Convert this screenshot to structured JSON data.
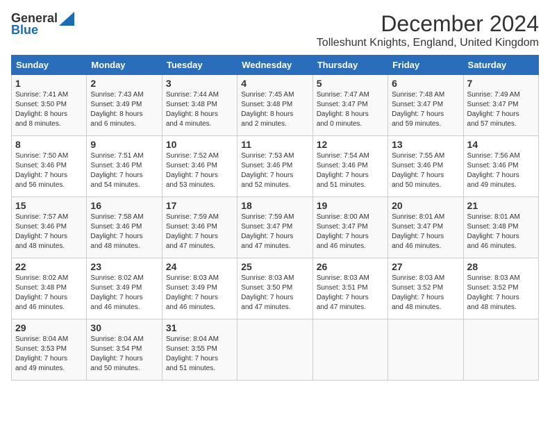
{
  "header": {
    "logo_general": "General",
    "logo_blue": "Blue",
    "month": "December 2024",
    "location": "Tolleshunt Knights, England, United Kingdom"
  },
  "days_of_week": [
    "Sunday",
    "Monday",
    "Tuesday",
    "Wednesday",
    "Thursday",
    "Friday",
    "Saturday"
  ],
  "weeks": [
    [
      {
        "day": 1,
        "info": "Sunrise: 7:41 AM\nSunset: 3:50 PM\nDaylight: 8 hours\nand 8 minutes."
      },
      {
        "day": 2,
        "info": "Sunrise: 7:43 AM\nSunset: 3:49 PM\nDaylight: 8 hours\nand 6 minutes."
      },
      {
        "day": 3,
        "info": "Sunrise: 7:44 AM\nSunset: 3:48 PM\nDaylight: 8 hours\nand 4 minutes."
      },
      {
        "day": 4,
        "info": "Sunrise: 7:45 AM\nSunset: 3:48 PM\nDaylight: 8 hours\nand 2 minutes."
      },
      {
        "day": 5,
        "info": "Sunrise: 7:47 AM\nSunset: 3:47 PM\nDaylight: 8 hours\nand 0 minutes."
      },
      {
        "day": 6,
        "info": "Sunrise: 7:48 AM\nSunset: 3:47 PM\nDaylight: 7 hours\nand 59 minutes."
      },
      {
        "day": 7,
        "info": "Sunrise: 7:49 AM\nSunset: 3:47 PM\nDaylight: 7 hours\nand 57 minutes."
      }
    ],
    [
      {
        "day": 8,
        "info": "Sunrise: 7:50 AM\nSunset: 3:46 PM\nDaylight: 7 hours\nand 56 minutes."
      },
      {
        "day": 9,
        "info": "Sunrise: 7:51 AM\nSunset: 3:46 PM\nDaylight: 7 hours\nand 54 minutes."
      },
      {
        "day": 10,
        "info": "Sunrise: 7:52 AM\nSunset: 3:46 PM\nDaylight: 7 hours\nand 53 minutes."
      },
      {
        "day": 11,
        "info": "Sunrise: 7:53 AM\nSunset: 3:46 PM\nDaylight: 7 hours\nand 52 minutes."
      },
      {
        "day": 12,
        "info": "Sunrise: 7:54 AM\nSunset: 3:46 PM\nDaylight: 7 hours\nand 51 minutes."
      },
      {
        "day": 13,
        "info": "Sunrise: 7:55 AM\nSunset: 3:46 PM\nDaylight: 7 hours\nand 50 minutes."
      },
      {
        "day": 14,
        "info": "Sunrise: 7:56 AM\nSunset: 3:46 PM\nDaylight: 7 hours\nand 49 minutes."
      }
    ],
    [
      {
        "day": 15,
        "info": "Sunrise: 7:57 AM\nSunset: 3:46 PM\nDaylight: 7 hours\nand 48 minutes."
      },
      {
        "day": 16,
        "info": "Sunrise: 7:58 AM\nSunset: 3:46 PM\nDaylight: 7 hours\nand 48 minutes."
      },
      {
        "day": 17,
        "info": "Sunrise: 7:59 AM\nSunset: 3:46 PM\nDaylight: 7 hours\nand 47 minutes."
      },
      {
        "day": 18,
        "info": "Sunrise: 7:59 AM\nSunset: 3:47 PM\nDaylight: 7 hours\nand 47 minutes."
      },
      {
        "day": 19,
        "info": "Sunrise: 8:00 AM\nSunset: 3:47 PM\nDaylight: 7 hours\nand 46 minutes."
      },
      {
        "day": 20,
        "info": "Sunrise: 8:01 AM\nSunset: 3:47 PM\nDaylight: 7 hours\nand 46 minutes."
      },
      {
        "day": 21,
        "info": "Sunrise: 8:01 AM\nSunset: 3:48 PM\nDaylight: 7 hours\nand 46 minutes."
      }
    ],
    [
      {
        "day": 22,
        "info": "Sunrise: 8:02 AM\nSunset: 3:48 PM\nDaylight: 7 hours\nand 46 minutes."
      },
      {
        "day": 23,
        "info": "Sunrise: 8:02 AM\nSunset: 3:49 PM\nDaylight: 7 hours\nand 46 minutes."
      },
      {
        "day": 24,
        "info": "Sunrise: 8:03 AM\nSunset: 3:49 PM\nDaylight: 7 hours\nand 46 minutes."
      },
      {
        "day": 25,
        "info": "Sunrise: 8:03 AM\nSunset: 3:50 PM\nDaylight: 7 hours\nand 47 minutes."
      },
      {
        "day": 26,
        "info": "Sunrise: 8:03 AM\nSunset: 3:51 PM\nDaylight: 7 hours\nand 47 minutes."
      },
      {
        "day": 27,
        "info": "Sunrise: 8:03 AM\nSunset: 3:52 PM\nDaylight: 7 hours\nand 48 minutes."
      },
      {
        "day": 28,
        "info": "Sunrise: 8:03 AM\nSunset: 3:52 PM\nDaylight: 7 hours\nand 48 minutes."
      }
    ],
    [
      {
        "day": 29,
        "info": "Sunrise: 8:04 AM\nSunset: 3:53 PM\nDaylight: 7 hours\nand 49 minutes."
      },
      {
        "day": 30,
        "info": "Sunrise: 8:04 AM\nSunset: 3:54 PM\nDaylight: 7 hours\nand 50 minutes."
      },
      {
        "day": 31,
        "info": "Sunrise: 8:04 AM\nSunset: 3:55 PM\nDaylight: 7 hours\nand 51 minutes."
      },
      null,
      null,
      null,
      null
    ]
  ]
}
